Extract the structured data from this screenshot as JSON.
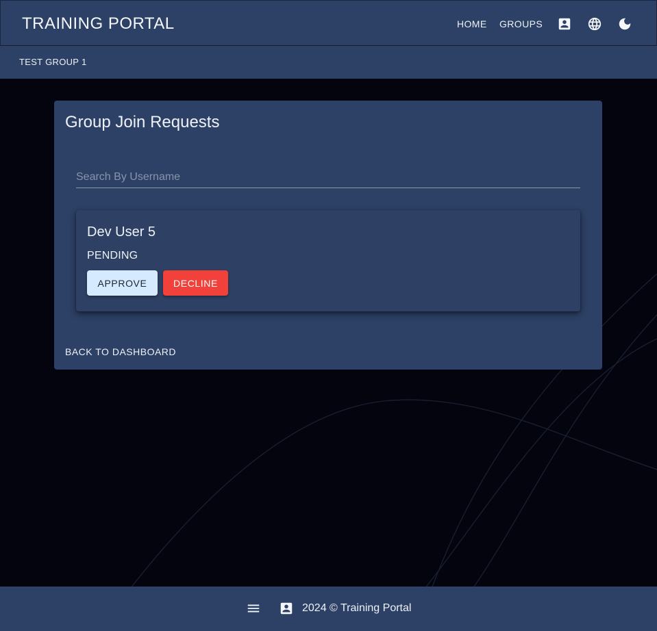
{
  "header": {
    "brand": "TRAINING PORTAL",
    "nav": [
      "HOME",
      "GROUPS"
    ],
    "icons": [
      "account-box-icon",
      "globe-icon",
      "moon-icon"
    ]
  },
  "breadcrumb": {
    "group": "TEST GROUP 1"
  },
  "main": {
    "title": "Group Join Requests",
    "search": {
      "placeholder": "Search By Username",
      "value": ""
    },
    "requests": [
      {
        "username": "Dev User 5",
        "status": "PENDING",
        "approve_label": "APPROVE",
        "decline_label": "DECLINE"
      }
    ],
    "back_label": "BACK TO DASHBOARD"
  },
  "footer": {
    "text": "2024 © Training Portal",
    "icons": [
      "menu-icon",
      "account-box-icon"
    ]
  },
  "colors": {
    "background": "#03040e",
    "surface": "#2d4166",
    "approve": "#d6eaff",
    "decline": "#f2413a",
    "text": "#eef2f8"
  }
}
